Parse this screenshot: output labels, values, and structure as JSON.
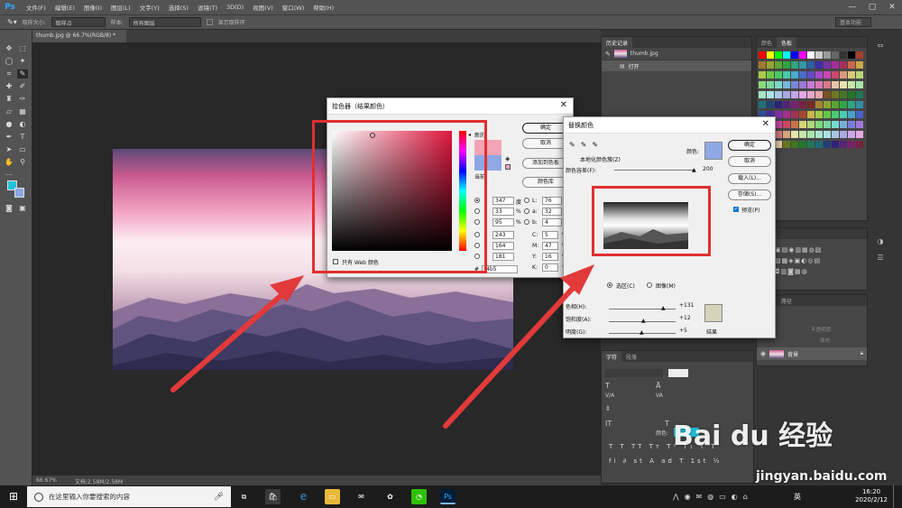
{
  "menubar": {
    "logo": "Ps",
    "items": [
      "文件(F)",
      "编辑(E)",
      "图像(I)",
      "图层(L)",
      "文字(Y)",
      "选择(S)",
      "滤镜(T)",
      "3D(D)",
      "视图(V)",
      "窗口(W)",
      "帮助(H)"
    ],
    "minimize": "—",
    "maximize": "▢",
    "close": "✕"
  },
  "optionsbar": {
    "sample_size_label": "取样大小:",
    "sample_size_value": "取样点",
    "sample_label": "样本:",
    "sample_value": "所有图层",
    "show_ring_label": "显示取样环",
    "workspace": "基本功能"
  },
  "document": {
    "tab_title": "thumb.jpg @ 66.7%(RGB/8) *",
    "zoom": "66.67%",
    "doc_size": "文档:2.58M/2.58M"
  },
  "color_picker": {
    "title": "拾色器（结果颜色）",
    "close": "✕",
    "ok": "确定",
    "cancel": "取消",
    "add_swatch": "添加到色板",
    "color_library": "颜色库",
    "new_label": "新的",
    "current_label": "当前",
    "web_only": "只有 Web 颜色",
    "H": "347",
    "H_unit": "度",
    "S": "33",
    "S_unit": "%",
    "B": "95",
    "B_unit": "%",
    "R": "243",
    "G": "164",
    "B_val": "181",
    "L_lbl": "L:",
    "L": "76",
    "a_lbl": "a:",
    "a": "32",
    "b_lbl": "b:",
    "b": "4",
    "C_lbl": "C:",
    "C": "5",
    "M_lbl": "M:",
    "M": "47",
    "Y_lbl": "Y:",
    "Y": "16",
    "K_lbl": "K:",
    "K": "0",
    "pct": "%",
    "hex_prefix": "#",
    "hex": "f4b5"
  },
  "replace_color": {
    "title": "替换颜色",
    "close": "✕",
    "localized_clusters": "本地化颜色簇(Z)",
    "color_label": "颜色:",
    "fuzziness_label": "颜色容差(F):",
    "fuzziness": "200",
    "ok": "确定",
    "cancel": "取消",
    "load": "载入(L)...",
    "save": "存储(S)...",
    "preview": "预览(P)",
    "selection": "选区(C)",
    "image": "图像(M)",
    "hue_label": "色相(H):",
    "hue": "+131",
    "sat_label": "饱和度(A):",
    "sat": "+12",
    "light_label": "明度(G):",
    "light": "+5",
    "result_label": "结果",
    "swatch_color": "#8fa8e6",
    "result_color": "#d6d4b8"
  },
  "panels": {
    "history_tab": "历史记录",
    "history_items": [
      "thumb.jpg",
      "打开"
    ],
    "color_tab": "颜色",
    "swatches_tab": "色板",
    "styles_tab": "样式",
    "channels_tab": "通道",
    "paths_tab": "路径",
    "layers": {
      "opacity_label": "不透明度:",
      "fill_label": "填充:",
      "layer_name": "背景"
    },
    "character_tab": "字符",
    "paragraph_tab": "段落",
    "color_label": "颜色:"
  },
  "taskbar": {
    "search_placeholder": "在这里输入你要搜索的内容",
    "ime": "英",
    "time": "16:20",
    "date": "2020/2/12"
  },
  "watermark": {
    "brand": "Bai du 经验",
    "url": "jingyan.baidu.com"
  }
}
